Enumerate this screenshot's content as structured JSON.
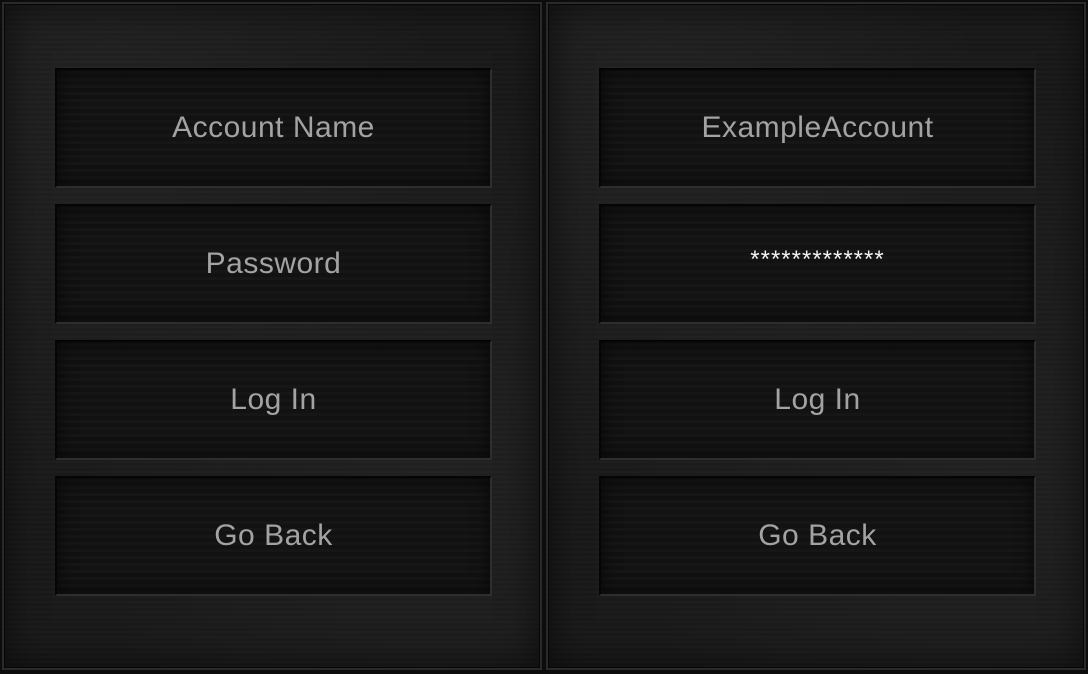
{
  "left_panel": {
    "account_label": "Account Name",
    "password_label": "Password",
    "login_button": "Log In",
    "back_button": "Go Back"
  },
  "right_panel": {
    "account_value": "ExampleAccount",
    "password_value": "*************",
    "login_button": "Log In",
    "back_button": "Go Back"
  },
  "colors": {
    "background": "#1a1a1a",
    "field_background": "#121212",
    "label_text": "#a3a3a3",
    "password_text": "#f2f2f2"
  }
}
